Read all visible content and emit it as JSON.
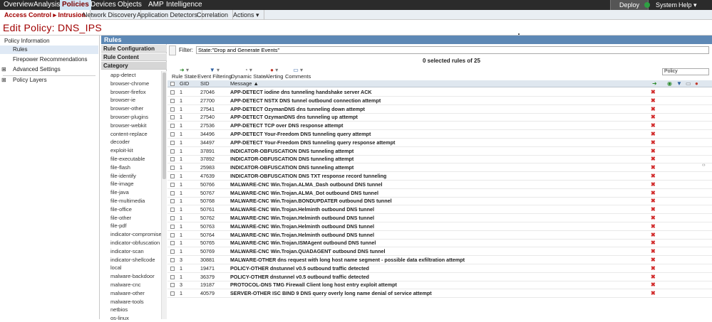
{
  "topnav": {
    "items": [
      "Overview",
      "Analysis",
      "Policies",
      "Devices",
      "Objects",
      "AMP",
      "Intelligence"
    ],
    "deploy": "Deploy",
    "system": "System",
    "help": "Help ▾"
  },
  "subnav": {
    "items": [
      "Access Control ▸ Intrusion",
      "Network Discovery",
      "Application Detectors",
      "Correlation",
      "Actions ▾"
    ]
  },
  "page_title": "Edit Policy: DNS_IPS",
  "leftnav": {
    "items": [
      "Policy Information",
      "Rules",
      "Firepower Recommendations",
      "Advanced Settings",
      "Policy Layers"
    ],
    "expand_glyph": "⊞"
  },
  "rules_panel": {
    "header": "Rules",
    "sections": [
      "Rule Configuration",
      "Rule Content",
      "Category"
    ],
    "categories": [
      "app-detect",
      "browser-chrome",
      "browser-firefox",
      "browser-ie",
      "browser-other",
      "browser-plugins",
      "browser-webkit",
      "content-replace",
      "decoder",
      "exploit-kit",
      "file-executable",
      "file-flash",
      "file-identify",
      "file-image",
      "file-java",
      "file-multimedia",
      "file-office",
      "file-other",
      "file-pdf",
      "indicator-compromise",
      "indicator-obfuscation",
      "indicator-scan",
      "indicator-shellcode",
      "local",
      "malware-backdoor",
      "malware-cnc",
      "malware-other",
      "malware-tools",
      "netbios",
      "os-linux"
    ]
  },
  "filter": {
    "label": "Filter:",
    "value": "State:\"Drop and Generate Events\""
  },
  "selected_count": "0 selected rules of 25",
  "toolbar": {
    "rule_state": "Rule State",
    "event_filtering": "Event Filtering",
    "dynamic_state": "Dynamic State",
    "alerting": "Alerting",
    "comments": "Comments",
    "policy_select": "Policy"
  },
  "table": {
    "headers": {
      "gid": "GID",
      "sid": "SID",
      "message": "Message ▲"
    },
    "rows": [
      {
        "gid": "1",
        "sid": "27046",
        "msg": "APP-DETECT iodine dns tunneling handshake server ACK"
      },
      {
        "gid": "1",
        "sid": "27700",
        "msg": "APP-DETECT NSTX DNS tunnel outbound connection attempt"
      },
      {
        "gid": "1",
        "sid": "27541",
        "msg": "APP-DETECT OzymanDNS dns tunneling down attempt"
      },
      {
        "gid": "1",
        "sid": "27540",
        "msg": "APP-DETECT OzymanDNS dns tunneling up attempt"
      },
      {
        "gid": "1",
        "sid": "27536",
        "msg": "APP-DETECT TCP over DNS response attempt"
      },
      {
        "gid": "1",
        "sid": "34496",
        "msg": "APP-DETECT Your-Freedom DNS tunneling query attempt"
      },
      {
        "gid": "1",
        "sid": "34497",
        "msg": "APP-DETECT Your-Freedom DNS tunneling query response attempt"
      },
      {
        "gid": "1",
        "sid": "37891",
        "msg": "INDICATOR-OBFUSCATION DNS tunneling attempt"
      },
      {
        "gid": "1",
        "sid": "37892",
        "msg": "INDICATOR-OBFUSCATION DNS tunneling attempt"
      },
      {
        "gid": "1",
        "sid": "25983",
        "msg": "INDICATOR-OBFUSCATION DNS tunneling attempt"
      },
      {
        "gid": "1",
        "sid": "47639",
        "msg": "INDICATOR-OBFUSCATION DNS TXT response record tunneling"
      },
      {
        "gid": "1",
        "sid": "50766",
        "msg": "MALWARE-CNC Win.Trojan.ALMA_Dash outbound DNS tunnel"
      },
      {
        "gid": "1",
        "sid": "50767",
        "msg": "MALWARE-CNC Win.Trojan.ALMA_Dot outbound DNS tunnel"
      },
      {
        "gid": "1",
        "sid": "50768",
        "msg": "MALWARE-CNC Win.Trojan.BONDUPDATER outbound DNS tunnel"
      },
      {
        "gid": "1",
        "sid": "50761",
        "msg": "MALWARE-CNC Win.Trojan.Helminth outbound DNS tunnel"
      },
      {
        "gid": "1",
        "sid": "50762",
        "msg": "MALWARE-CNC Win.Trojan.Helminth outbound DNS tunnel"
      },
      {
        "gid": "1",
        "sid": "50763",
        "msg": "MALWARE-CNC Win.Trojan.Helminth outbound DNS tunnel"
      },
      {
        "gid": "1",
        "sid": "50764",
        "msg": "MALWARE-CNC Win.Trojan.Helminth outbound DNS tunnel"
      },
      {
        "gid": "1",
        "sid": "50765",
        "msg": "MALWARE-CNC Win.Trojan.ISMAgent outbound DNS tunnel"
      },
      {
        "gid": "1",
        "sid": "50769",
        "msg": "MALWARE-CNC Win.Trojan.QUADAGENT outbound DNS tunnel"
      },
      {
        "gid": "3",
        "sid": "30881",
        "msg": "MALWARE-OTHER dns request with long host name segment - possible data exfiltration attempt"
      },
      {
        "gid": "1",
        "sid": "19471",
        "msg": "POLICY-OTHER dnstunnel v0.5 outbound traffic detected"
      },
      {
        "gid": "1",
        "sid": "36379",
        "msg": "POLICY-OTHER dnstunnel v0.5 outbound traffic detected"
      },
      {
        "gid": "3",
        "sid": "19187",
        "msg": "PROTOCOL-DNS TMG Firewall Client long host entry exploit attempt"
      },
      {
        "gid": "1",
        "sid": "40579",
        "msg": "SERVER-OTHER ISC BIND 9 DNS query overly long name denial of service attempt"
      }
    ],
    "state_glyph": "✖"
  },
  "colors": {
    "nav_bg": "#2b2b2b",
    "accent_red": "#a00000",
    "rules_header": "#5d88b5",
    "drop_red": "#d12a2a"
  }
}
